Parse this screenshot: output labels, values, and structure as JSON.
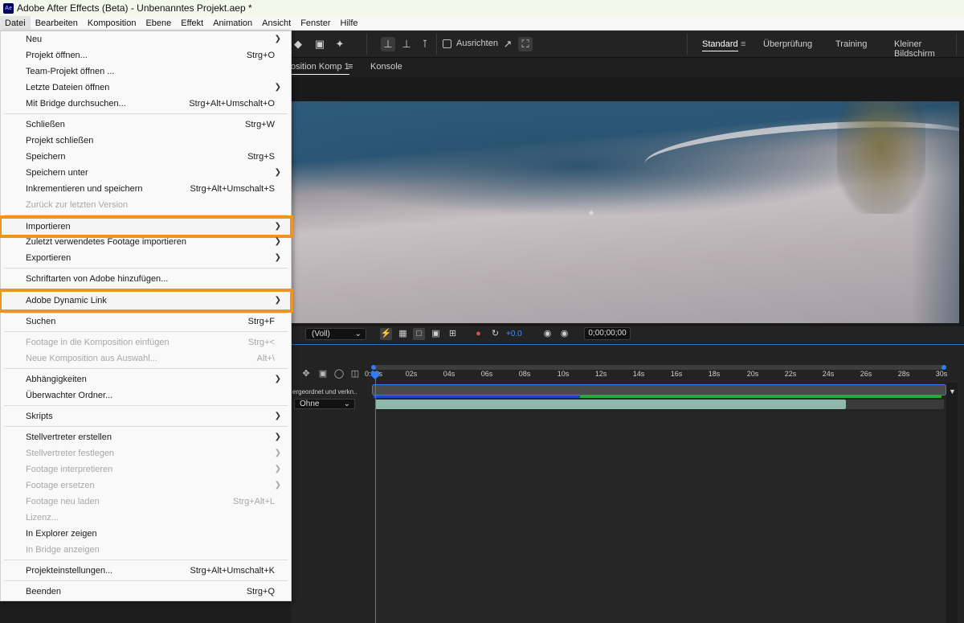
{
  "window": {
    "app_icon": "Ae",
    "title": "Adobe After Effects (Beta) - Unbenanntes Projekt.aep *"
  },
  "menubar": [
    "Datei",
    "Bearbeiten",
    "Komposition",
    "Ebene",
    "Effekt",
    "Animation",
    "Ansicht",
    "Fenster",
    "Hilfe"
  ],
  "toolbar": {
    "icons": [
      "eraser-icon",
      "roto-brush-icon",
      "puppet-pin-icon",
      "axis-local-icon",
      "axis-world-icon",
      "axis-view-icon",
      "snap-icon",
      "snap-target-icon"
    ],
    "snapping_label": "Ausrichten",
    "snapping_checked": false
  },
  "workspaces": [
    {
      "label": "Standard",
      "active": true
    },
    {
      "label": "Überprüfung",
      "active": false
    },
    {
      "label": "Training",
      "active": false
    },
    {
      "label": "Kleiner Bildschirm",
      "active": false
    }
  ],
  "comp_tabs": {
    "comp": "osition Komp 1",
    "console": "Konsole"
  },
  "viewer": {
    "resolution": "(Voll)",
    "exposure": "+0.0",
    "timecode": "0;00;00;00",
    "accent": "#4a8cff"
  },
  "timeline": {
    "ticks": [
      "0:00s",
      "02s",
      "04s",
      "06s",
      "08s",
      "10s",
      "12s",
      "14s",
      "16s",
      "18s",
      "20s",
      "22s",
      "24s",
      "26s",
      "28s",
      "30s"
    ],
    "parent_header": "ergeordnet und verkn..",
    "parent_value": "Ohne",
    "playhead_color": "#2e7cf6",
    "layer_color": "#8fb8ad",
    "render_done_color": "#29a84a"
  },
  "file_menu": {
    "highlight_color": "#ef9420",
    "items": [
      {
        "label": "Neu",
        "shortcut": "",
        "submenu": true,
        "disabled": false
      },
      {
        "label": "Projekt öffnen...",
        "shortcut": "Strg+O",
        "submenu": false,
        "disabled": false
      },
      {
        "label": "Team-Projekt öffnen ...",
        "shortcut": "",
        "submenu": false,
        "disabled": false
      },
      {
        "label": "Letzte Dateien öffnen",
        "shortcut": "",
        "submenu": true,
        "disabled": false
      },
      {
        "label": "Mit Bridge durchsuchen...",
        "shortcut": "Strg+Alt+Umschalt+O",
        "submenu": false,
        "disabled": false
      },
      {
        "label": "Schließen",
        "shortcut": "Strg+W",
        "submenu": false,
        "disabled": false
      },
      {
        "label": "Projekt schließen",
        "shortcut": "",
        "submenu": false,
        "disabled": false
      },
      {
        "label": "Speichern",
        "shortcut": "Strg+S",
        "submenu": false,
        "disabled": false
      },
      {
        "label": "Speichern unter",
        "shortcut": "",
        "submenu": true,
        "disabled": false
      },
      {
        "label": "Inkrementieren und speichern",
        "shortcut": "Strg+Alt+Umschalt+S",
        "submenu": false,
        "disabled": false
      },
      {
        "label": "Zurück zur letzten Version",
        "shortcut": "",
        "submenu": false,
        "disabled": true
      },
      {
        "label": "Importieren",
        "shortcut": "",
        "submenu": true,
        "disabled": false,
        "highlighted": true
      },
      {
        "label": "Zuletzt verwendetes Footage importieren",
        "shortcut": "",
        "submenu": true,
        "disabled": false
      },
      {
        "label": "Exportieren",
        "shortcut": "",
        "submenu": true,
        "disabled": false
      },
      {
        "label": "Schriftarten von Adobe hinzufügen...",
        "shortcut": "",
        "submenu": false,
        "disabled": false
      },
      {
        "label": "Adobe Dynamic Link",
        "shortcut": "",
        "submenu": true,
        "disabled": false,
        "highlighted": true
      },
      {
        "label": "Suchen",
        "shortcut": "Strg+F",
        "submenu": false,
        "disabled": false
      },
      {
        "label": "Footage in die Komposition einfügen",
        "shortcut": "Strg+<",
        "submenu": false,
        "disabled": true
      },
      {
        "label": "Neue Komposition aus Auswahl...",
        "shortcut": "Alt+\\",
        "submenu": false,
        "disabled": true
      },
      {
        "label": "Abhängigkeiten",
        "shortcut": "",
        "submenu": true,
        "disabled": false
      },
      {
        "label": "Überwachter Ordner...",
        "shortcut": "",
        "submenu": false,
        "disabled": false
      },
      {
        "label": "Skripts",
        "shortcut": "",
        "submenu": true,
        "disabled": false
      },
      {
        "label": "Stellvertreter erstellen",
        "shortcut": "",
        "submenu": true,
        "disabled": false
      },
      {
        "label": "Stellvertreter festlegen",
        "shortcut": "",
        "submenu": true,
        "disabled": true
      },
      {
        "label": "Footage interpretieren",
        "shortcut": "",
        "submenu": true,
        "disabled": true
      },
      {
        "label": "Footage ersetzen",
        "shortcut": "",
        "submenu": true,
        "disabled": true
      },
      {
        "label": "Footage neu laden",
        "shortcut": "Strg+Alt+L",
        "submenu": false,
        "disabled": true
      },
      {
        "label": "Lizenz...",
        "shortcut": "",
        "submenu": false,
        "disabled": true
      },
      {
        "label": "In Explorer zeigen",
        "shortcut": "",
        "submenu": false,
        "disabled": false
      },
      {
        "label": "In Bridge anzeigen",
        "shortcut": "",
        "submenu": false,
        "disabled": true
      },
      {
        "label": "Projekteinstellungen...",
        "shortcut": "Strg+Alt+Umschalt+K",
        "submenu": false,
        "disabled": false
      },
      {
        "label": "Beenden",
        "shortcut": "Strg+Q",
        "submenu": false,
        "disabled": false
      }
    ]
  }
}
